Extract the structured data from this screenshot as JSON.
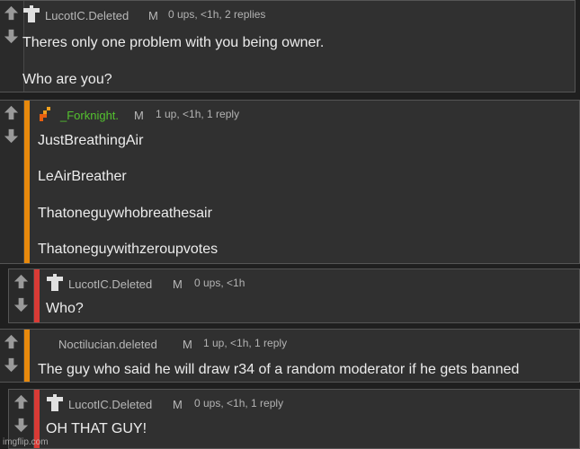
{
  "colors": {
    "bar_orange": "#e8890c",
    "bar_red": "#d93a35",
    "name_green": "#54c22f",
    "avatar_orange": "#f0a020"
  },
  "icons": {
    "upvote": "up-arrow-icon",
    "downvote": "down-arrow-icon",
    "avatar_default": "shirt-icon",
    "avatar_custom": "pixel-avatar-icon"
  },
  "comments": [
    {
      "username": "LucotIC.Deleted",
      "mod_badge": "M",
      "stats": "0 ups, <1h, 2 replies",
      "lines": [
        "Theres only one problem with you being owner.",
        "Who are you?"
      ]
    },
    {
      "username": "_Forknight.",
      "mod_badge": "M",
      "stats": "1 up, <1h, 1 reply",
      "lines": [
        "JustBreathingAir",
        "LeAirBreather",
        "Thatoneguywhobreathesair",
        "Thatoneguywithzeroupvotes"
      ]
    },
    {
      "username": "LucotIC.Deleted",
      "mod_badge": "M",
      "stats": "0 ups, <1h",
      "lines": [
        "Who?"
      ]
    },
    {
      "username": "Noctilucian.deleted",
      "mod_badge": "M",
      "stats": "1 up, <1h, 1 reply",
      "lines": [
        "The guy who said he will draw r34 of a random moderator if he gets banned"
      ]
    },
    {
      "username": "LucotIC.Deleted",
      "mod_badge": "M",
      "stats": "0 ups, <1h, 1 reply",
      "lines": [
        "OH THAT GUY!"
      ]
    }
  ],
  "watermark": "imgflip.com"
}
